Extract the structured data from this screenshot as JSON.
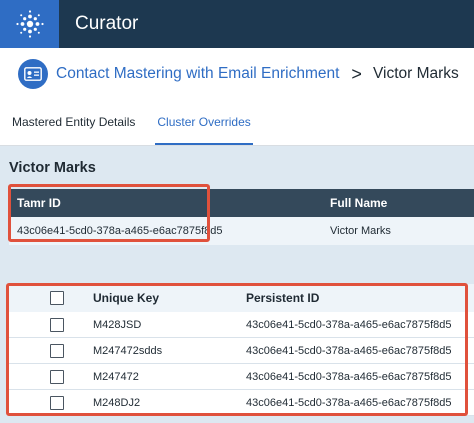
{
  "app": {
    "title": "Curator"
  },
  "breadcrumb": {
    "project": "Contact Mastering with Email Enrichment",
    "separator": ">",
    "current": "Victor Marks"
  },
  "tabs": [
    {
      "label": "Mastered Entity Details",
      "active": false
    },
    {
      "label": "Cluster Overrides",
      "active": true
    }
  ],
  "entity": {
    "title": "Victor Marks"
  },
  "entity_table": {
    "columns": [
      "Tamr ID",
      "Full Name"
    ],
    "row": {
      "tamr_id": "43c06e41-5cd0-378a-a465-e6ac7875f8d5",
      "full_name": "Victor Marks"
    }
  },
  "records_table": {
    "columns": [
      "Unique Key",
      "Persistent ID"
    ],
    "rows": [
      {
        "unique_key": "M428JSD",
        "persistent_id": "43c06e41-5cd0-378a-a465-e6ac7875f8d5"
      },
      {
        "unique_key": "M247472sdds",
        "persistent_id": "43c06e41-5cd0-378a-a465-e6ac7875f8d5"
      },
      {
        "unique_key": "M247472",
        "persistent_id": "43c06e41-5cd0-378a-a465-e6ac7875f8d5"
      },
      {
        "unique_key": "M248DJ2",
        "persistent_id": "43c06e41-5cd0-378a-a465-e6ac7875f8d5"
      }
    ]
  },
  "colors": {
    "header_bg": "#1d3850",
    "logo_bg": "#2f6dc4",
    "accent": "#2f6dc4",
    "highlight": "#e0513c",
    "panel_bg": "#dde8f1"
  }
}
